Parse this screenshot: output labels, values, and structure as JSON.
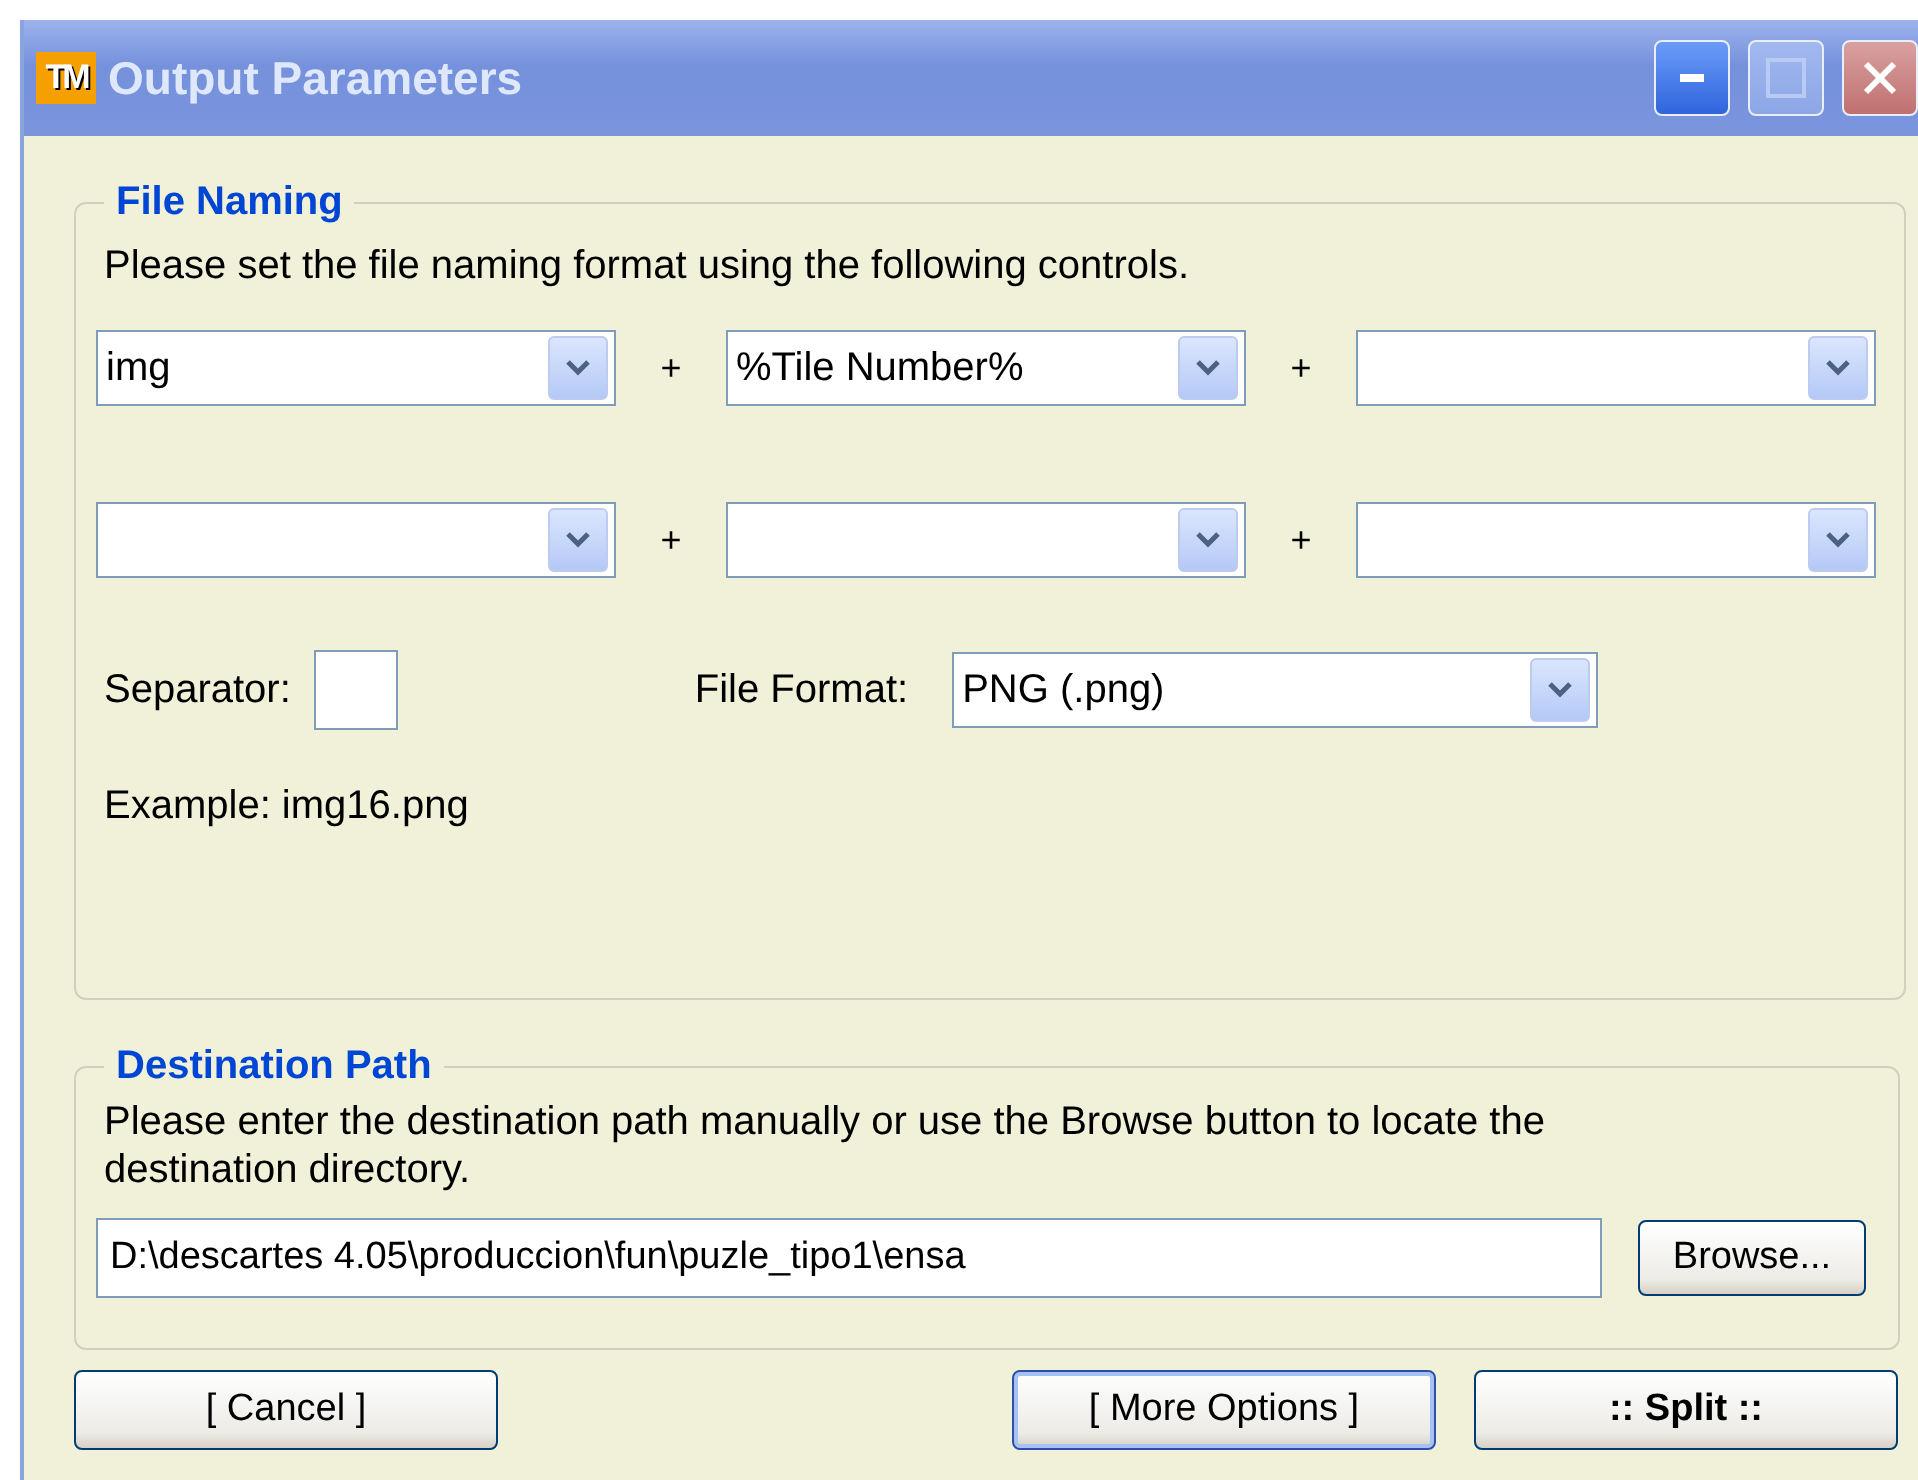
{
  "window": {
    "title": "Output Parameters",
    "icon_text": "TM"
  },
  "file_naming": {
    "legend": "File Naming",
    "instructions": "Please set the file naming format using the following controls.",
    "combo_rows": [
      [
        "img",
        "%Tile Number%",
        null
      ],
      [
        null,
        null,
        null
      ]
    ],
    "joiner": "+",
    "separator_label": "Separator:",
    "file_format_label": "File Format:",
    "file_format": "PNG (.png)",
    "example": "Example: img16.png"
  },
  "destination": {
    "legend": "Destination Path",
    "instructions": "Please enter the destination path manually or use the Browse button to locate the destination directory.",
    "path": "D:\\descartes 4.05\\produccion\\fun\\puzle_tipo1\\ensa",
    "browse": "Browse..."
  },
  "buttons": [
    {
      "label": "[ Cancel ]",
      "kind": "normal",
      "focused": false
    },
    {
      "label": "[ More Options ]",
      "kind": "normal",
      "focused": true
    },
    {
      "label": ":: Split ::",
      "kind": "strong",
      "focused": false
    }
  ]
}
